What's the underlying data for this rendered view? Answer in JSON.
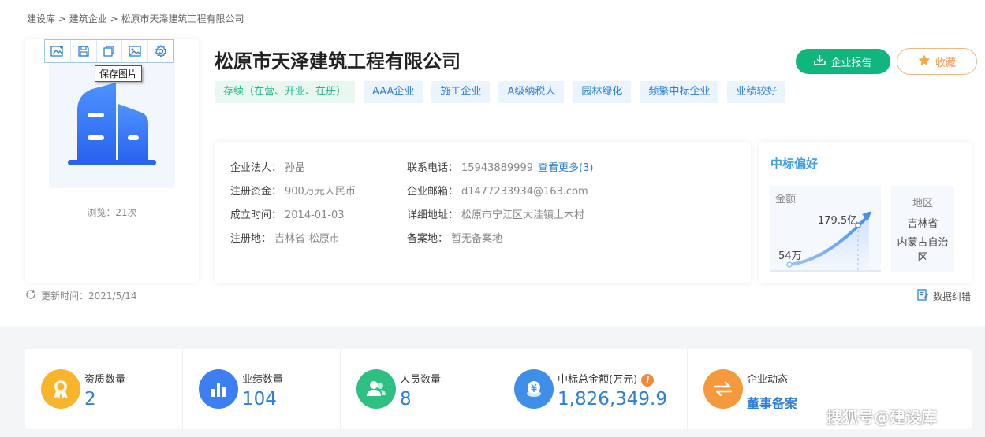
{
  "breadcrumb": [
    "建设库",
    "建筑企业",
    "松原市天泽建筑工程有限公司"
  ],
  "breadcrumb_sep": ">",
  "logo_tools": {
    "tooltip": "保存图片",
    "icons": [
      "add-image-icon",
      "save-icon",
      "copy-icon",
      "image-icon",
      "gear-icon"
    ]
  },
  "views": "浏览：21次",
  "update_time": "更新时间：2021/5/14",
  "company_name": "松原市天泽建筑工程有限公司",
  "tags": [
    "存续（在营、开业、在册）",
    "AAA企业",
    "施工企业",
    "A级纳税人",
    "园林绿化",
    "频繁中标企业",
    "业绩较好"
  ],
  "buttons": {
    "report": "企业报告",
    "favorite": "收藏"
  },
  "info": {
    "legal_rep_label": "企业法人：",
    "legal_rep": "孙晶",
    "capital_label": "注册资金：",
    "capital": "900万元人民币",
    "founded_label": "成立时间：",
    "founded": "2014-01-03",
    "reg_place_label": "注册地：",
    "reg_place": "吉林省-松原市",
    "phone_label": "联系电话：",
    "phone": "15943889999",
    "phone_more": "查看更多(3)",
    "email_label": "企业邮箱：",
    "email": "d1477233934@163.com",
    "address_label": "详细地址：",
    "address": "松原市宁江区大洼镇土木村",
    "record_label": "备案地：",
    "record": "暂无备案地"
  },
  "preference": {
    "title": "中标偏好",
    "amount_label": "金额",
    "amount_low": "54万",
    "amount_high": "179.5亿",
    "region_label": "地区",
    "regions": [
      "吉林省",
      "内蒙古自治区"
    ]
  },
  "correct_label": "数据纠错",
  "stats": [
    {
      "label": "资质数量",
      "value": "2",
      "icon": "medal-icon",
      "color": "#f7b52c"
    },
    {
      "label": "业绩数量",
      "value": "104",
      "icon": "bar-chart-icon",
      "color": "#3d7ef2"
    },
    {
      "label": "人员数量",
      "value": "8",
      "icon": "people-icon",
      "color": "#2ebf83"
    },
    {
      "label": "中标总金额(万元)",
      "value": "1,826,349.9",
      "icon": "coin-icon",
      "color": "#3f8ee8"
    },
    {
      "label": "企业动态",
      "value": "董事备案",
      "icon": "exchange-icon",
      "color": "#f59a3c"
    }
  ],
  "watermark": "搜狐号@建设库"
}
